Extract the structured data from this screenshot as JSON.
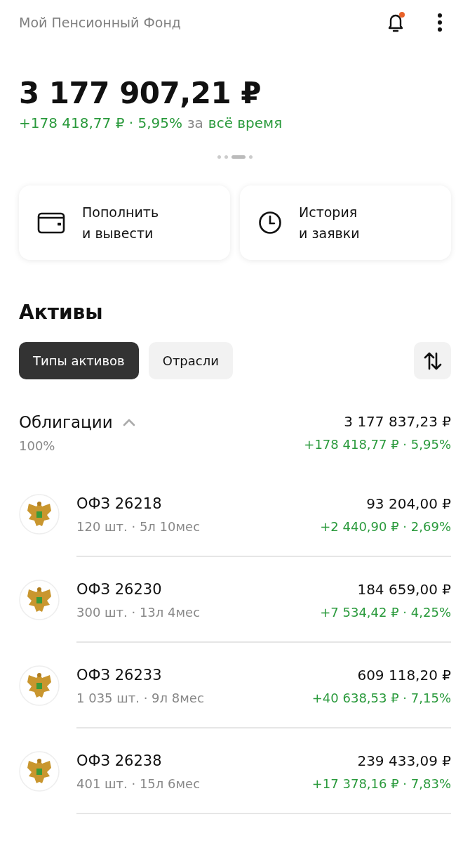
{
  "header": {
    "title": "Мой Пенсионный Фонд",
    "notification": true
  },
  "balance": {
    "total": "3 177 907,21 ₽",
    "gain": "+178 418,77 ₽ · 5,95%",
    "gain_prefix": "за",
    "period": "всё время"
  },
  "pager": [
    {
      "selected": false
    },
    {
      "selected": false
    },
    {
      "selected": true
    },
    {
      "selected": false
    }
  ],
  "actions": [
    {
      "kind": "wallet",
      "label": "Пополнить\nи вывести"
    },
    {
      "kind": "clock",
      "label": "История\nи заявки"
    }
  ],
  "assets": {
    "title": "Активы",
    "tabs": [
      {
        "label": "Типы активов",
        "selected": true
      },
      {
        "label": "Отрасли",
        "selected": false
      }
    ],
    "group": {
      "name": "Облигации",
      "expanded": true,
      "share": "100%",
      "value": "3 177 837,23 ₽",
      "gain": "+178 418,77 ₽ · 5,95%"
    },
    "items": [
      {
        "name": "ОФЗ 26218",
        "details": "120 шт. · 5л 10мес",
        "value": "93 204,00 ₽",
        "gain": "+2 440,90 ₽ · 2,69%"
      },
      {
        "name": "ОФЗ 26230",
        "details": "300 шт. · 13л 4мес",
        "value": "184 659,00 ₽",
        "gain": "+7 534,42 ₽ · 4,25%"
      },
      {
        "name": "ОФЗ 26233",
        "details": "1 035 шт. · 9л 8мес",
        "value": "609 118,20 ₽",
        "gain": "+40 638,53 ₽ · 7,15%"
      },
      {
        "name": "ОФЗ 26238",
        "details": "401 шт. · 15л 6мес",
        "value": "239 433,09 ₽",
        "gain": "+17 378,16 ₽ · 7,83%"
      }
    ]
  }
}
